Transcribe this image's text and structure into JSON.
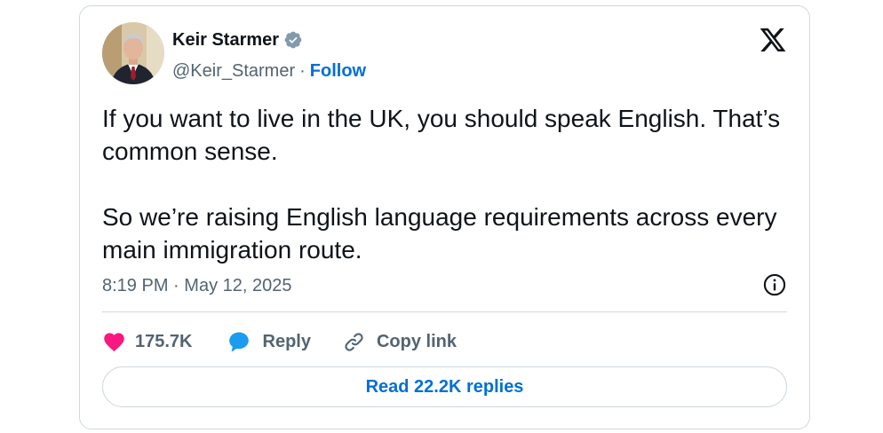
{
  "author": {
    "name": "Keir Starmer",
    "handle": "@Keir_Starmer",
    "separator": "·",
    "follow_label": "Follow"
  },
  "icons": {
    "avatar": "profile-photo",
    "verified": "verified-badge-icon",
    "brand": "x-logo-icon",
    "info": "info-icon",
    "like": "heart-icon",
    "reply": "speech-bubble-icon",
    "copy": "link-icon"
  },
  "tweet": {
    "paragraphs": [
      "If you want to live in the UK, you should speak English. That’s common sense.",
      "So we’re raising English language requirements across every main immigration route."
    ],
    "time": "8:19 PM",
    "separator": "·",
    "date": "May 12, 2025"
  },
  "actions": {
    "likes": "175.7K",
    "reply_label": "Reply",
    "copy_label": "Copy link"
  },
  "read_replies_label": "Read 22.2K replies",
  "colors": {
    "link_blue": "#006fd6",
    "like_pink": "#f91880",
    "reply_blue": "#1d9bf0",
    "muted_text": "#536471",
    "border": "#cfd9de",
    "verified_gray": "#829aab"
  }
}
